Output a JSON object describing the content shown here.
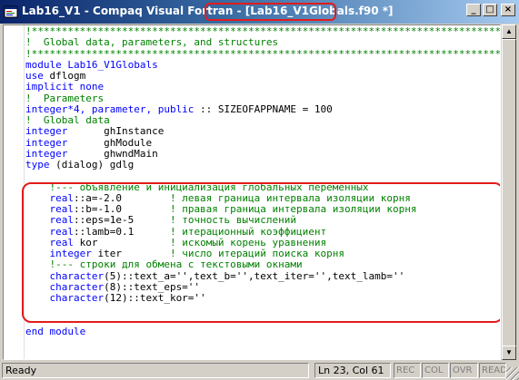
{
  "window": {
    "title_prefix": "Lab16_V1 - Compaq Visual Fortran - ",
    "title_file": "[Lab16_V1Globals.f90 *]",
    "buttons": {
      "minimize": "_",
      "maximize": "□",
      "close": "×"
    }
  },
  "code_lines": [
    [
      {
        "t": "!*****************************************************************************************",
        "c": "cmt"
      }
    ],
    [
      {
        "t": "!  Global data, parameters, and structures",
        "c": "cmt"
      }
    ],
    [
      {
        "t": "!*****************************************************************************************",
        "c": "cmt"
      }
    ],
    [
      {
        "t": "module Lab16_V1Globals",
        "c": "kw"
      }
    ],
    [
      {
        "t": "use",
        "c": "kw"
      },
      {
        "t": " dflogm",
        "c": ""
      }
    ],
    [
      {
        "t": "implicit none",
        "c": "kw"
      }
    ],
    [
      {
        "t": "!  Parameters",
        "c": "cmt"
      }
    ],
    [
      {
        "t": "integer*4, parameter, public",
        "c": "kw"
      },
      {
        "t": " :: SIZEOFAPPNAME = 100",
        "c": ""
      }
    ],
    [
      {
        "t": "!  Global data",
        "c": "cmt"
      }
    ],
    [
      {
        "t": "integer",
        "c": "kw"
      },
      {
        "t": "      ghInstance",
        "c": ""
      }
    ],
    [
      {
        "t": "integer",
        "c": "kw"
      },
      {
        "t": "      ghModule",
        "c": ""
      }
    ],
    [
      {
        "t": "integer",
        "c": "kw"
      },
      {
        "t": "      ghwndMain",
        "c": ""
      }
    ],
    [
      {
        "t": "type",
        "c": "kw"
      },
      {
        "t": " (dialog) gdlg",
        "c": ""
      }
    ],
    [
      {
        "t": "",
        "c": ""
      }
    ],
    [
      {
        "t": "    !--- объявление и инициализация глобальных переменных",
        "c": "cmt"
      }
    ],
    [
      {
        "t": "    real",
        "c": "kw"
      },
      {
        "t": "::a=-2.0",
        "c": ""
      },
      {
        "t": "        ! левая граница интервала изоляции корня",
        "c": "cmt"
      }
    ],
    [
      {
        "t": "    real",
        "c": "kw"
      },
      {
        "t": "::b=-1.0",
        "c": ""
      },
      {
        "t": "        ! правая граница интервала изоляции корня",
        "c": "cmt"
      }
    ],
    [
      {
        "t": "    real",
        "c": "kw"
      },
      {
        "t": "::eps=1e-5",
        "c": ""
      },
      {
        "t": "      ! точность вычислений",
        "c": "cmt"
      }
    ],
    [
      {
        "t": "    real",
        "c": "kw"
      },
      {
        "t": "::lamb=0.1",
        "c": ""
      },
      {
        "t": "      ! итерационный коэффициент",
        "c": "cmt"
      }
    ],
    [
      {
        "t": "    real",
        "c": "kw"
      },
      {
        "t": " kor",
        "c": ""
      },
      {
        "t": "            ! искомый корень уравнения",
        "c": "cmt"
      }
    ],
    [
      {
        "t": "    integer",
        "c": "kw"
      },
      {
        "t": " iter",
        "c": ""
      },
      {
        "t": "        ! число итераций поиска корня",
        "c": "cmt"
      }
    ],
    [
      {
        "t": "    !--- строки для обмена с текстовыми окнами",
        "c": "cmt"
      }
    ],
    [
      {
        "t": "    character",
        "c": "kw"
      },
      {
        "t": "(5)::text_a='',text_b='',text_iter='',text_lamb=''",
        "c": ""
      }
    ],
    [
      {
        "t": "    character",
        "c": "kw"
      },
      {
        "t": "(8)::text_eps=''",
        "c": ""
      }
    ],
    [
      {
        "t": "    character",
        "c": "kw"
      },
      {
        "t": "(12)::text_kor=''",
        "c": ""
      }
    ],
    [
      {
        "t": "",
        "c": ""
      }
    ],
    [
      {
        "t": "",
        "c": ""
      }
    ],
    [
      {
        "t": "end module",
        "c": "kw"
      }
    ]
  ],
  "status": {
    "message": "Ready",
    "position": "Ln 23, Col 61",
    "rec": "REC",
    "col": "COL",
    "ovr": "OVR",
    "read": "READ"
  },
  "colors": {
    "comment": "#008000",
    "keyword": "#0000ff",
    "highlight": "#e31b1b",
    "title_start": "#0a246a",
    "title_end": "#a6caf0"
  },
  "icons": [
    "app-icon",
    "minimize-icon",
    "maximize-icon",
    "close-icon",
    "scroll-up-icon",
    "scroll-down-icon",
    "size-grip-icon"
  ]
}
